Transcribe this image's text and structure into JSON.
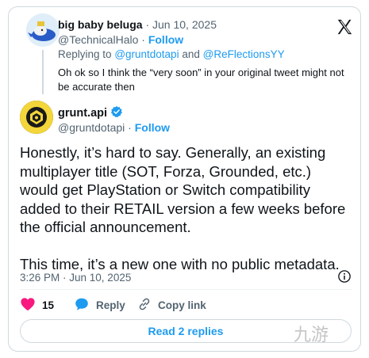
{
  "parent": {
    "name": "big baby beluga",
    "date": "· Jun 10, 2025",
    "handle": "@TechnicalHalo",
    "follow": "Follow",
    "separator": "·",
    "replying_prefix": "Replying to",
    "mention1": "@gruntdotapi",
    "and": "and",
    "mention2": "@ReFlectionsYY",
    "text": "Oh ok so I think the “very soon” in your original tweet might not be accurate then"
  },
  "tweet": {
    "name": "grunt.api",
    "handle": "@gruntdotapi",
    "follow": "Follow",
    "separator": "·",
    "paragraph1": "Honestly, it’s hard to say. Generally, an existing multiplayer title (SOT, Forza, Grounded, etc.) would get PlayStation or Switch compatibility added to their RETAIL version a few weeks before the official announcement.",
    "paragraph2": "This time, it’s a new one with no public metadata.",
    "timestamp": "3:26 PM · Jun 10, 2025"
  },
  "actions": {
    "like_count": "15",
    "reply_label": "Reply",
    "copy_label": "Copy link"
  },
  "read_replies": "Read 2 replies",
  "watermark": "九游",
  "colors": {
    "accent": "#1d9bf0",
    "like": "#f91880",
    "muted": "#536471"
  },
  "icons": [
    "x-logo-icon",
    "verified-badge-icon",
    "info-icon",
    "heart-icon",
    "reply-bubble-icon",
    "link-icon"
  ]
}
